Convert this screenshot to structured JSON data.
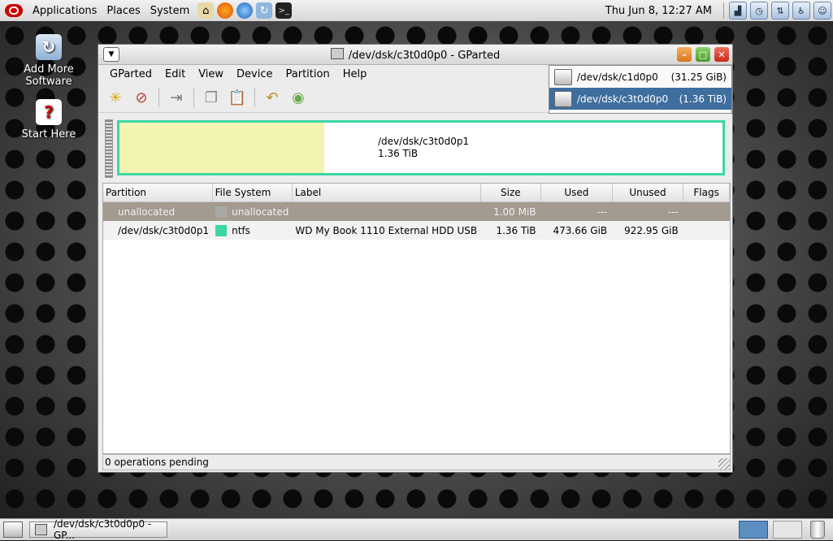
{
  "top_panel": {
    "menus": [
      "Applications",
      "Places",
      "System"
    ],
    "clock": "Thu Jun  8, 12:27 AM"
  },
  "desktop_icons": [
    {
      "label": "Add More Software"
    },
    {
      "label": "Start Here"
    }
  ],
  "window": {
    "title": "/dev/dsk/c3t0d0p0 - GParted",
    "menu": [
      "GParted",
      "Edit",
      "View",
      "Device",
      "Partition",
      "Help"
    ]
  },
  "device_list": [
    {
      "name": "/dev/dsk/c1d0p0",
      "size": "(31.25 GiB)",
      "selected": false
    },
    {
      "name": "/dev/dsk/c3t0d0p0",
      "size": "(1.36 TiB)",
      "selected": true
    }
  ],
  "graphic": {
    "partition": "/dev/dsk/c3t0d0p1",
    "size": "1.36 TiB"
  },
  "table": {
    "headers": [
      "Partition",
      "File System",
      "Label",
      "Size",
      "Used",
      "Unused",
      "Flags"
    ],
    "rows": [
      {
        "partition": "unallocated",
        "fs": "unallocated",
        "label": "",
        "size": "1.00 MiB",
        "used": "---",
        "unused": "---",
        "flags": ""
      },
      {
        "partition": "/dev/dsk/c3t0d0p1",
        "fs": "ntfs",
        "label": "WD My Book 1110 External HDD USB",
        "size": "1.36 TiB",
        "used": "473.66 GiB",
        "unused": "922.95 GiB",
        "flags": ""
      }
    ]
  },
  "status": "0 operations pending",
  "taskbar": {
    "task_label": "/dev/dsk/c3t0d0p0 - GP..."
  },
  "colors": {
    "ntfs": "#3dd6a3",
    "unallocated": "#a8a8a8",
    "selection": "#3e6e9e"
  }
}
